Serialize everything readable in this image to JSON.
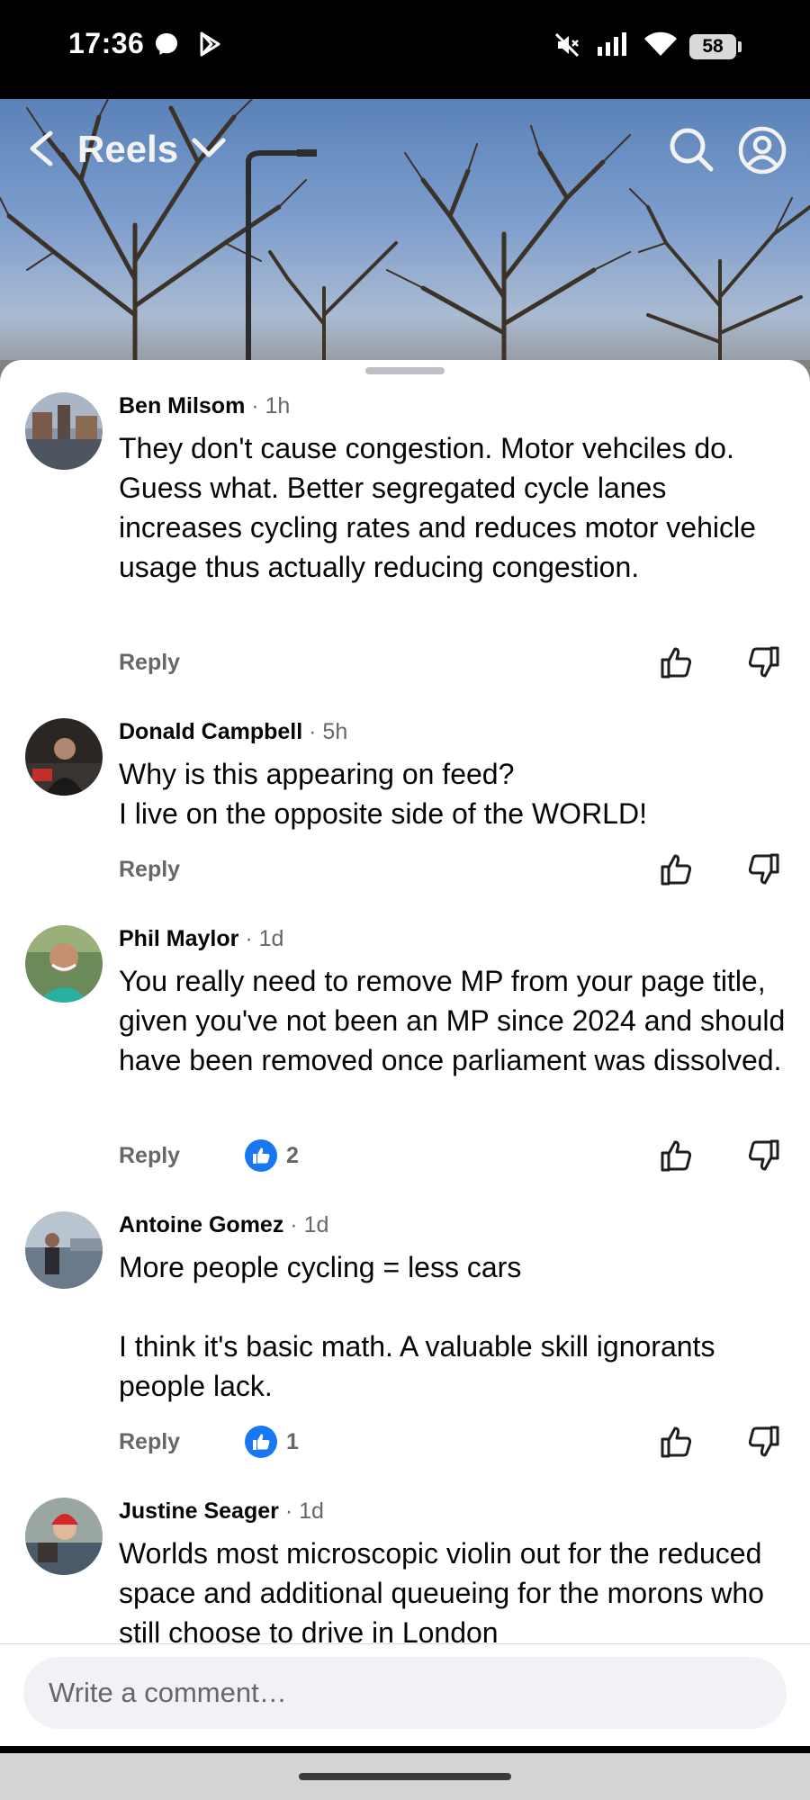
{
  "status_bar": {
    "time": "17:36",
    "battery": "58",
    "icons": [
      "messenger-icon",
      "play-store-icon",
      "mute-icon",
      "signal-icon",
      "wifi-icon",
      "battery-icon"
    ]
  },
  "header": {
    "title": "Reels"
  },
  "comments": [
    {
      "name": "Ben Milsom",
      "time": "· 1h",
      "lines": [
        "They don't cause congestion. Motor vehciles do. Guess what. Better segregated cycle lanes increases cycling rates and reduces motor vehicle usage thus actually reducing congestion."
      ],
      "reply_label": "Reply"
    },
    {
      "name": "Donald Campbell",
      "time": "· 5h",
      "lines": [
        "Why is this appearing on feed?",
        "I live on the opposite side of the WORLD!"
      ],
      "reply_label": "Reply"
    },
    {
      "name": "Phil Maylor",
      "time": "· 1d",
      "lines": [
        "You really need to remove MP from your page title, given you've not been an MP since 2024 and should have been removed once parliament was dissolved."
      ],
      "reply_label": "Reply",
      "reaction_count": "2"
    },
    {
      "name": "Antoine Gomez",
      "time": "· 1d",
      "lines": [
        "More people cycling = less cars",
        "",
        "I think it's basic math. A valuable skill ignorants people lack."
      ],
      "reply_label": "Reply",
      "reaction_count": "1"
    },
    {
      "name": "Justine Seager",
      "time": "· 1d",
      "lines": [
        "Worlds most microscopic violin out for the reduced space and additional queueing for the morons who still choose to drive in London"
      ]
    }
  ],
  "composer": {
    "placeholder": "Write a comment…"
  },
  "colors": {
    "like_blue": "#1877f2",
    "secondary_text": "#65676b",
    "input_bg": "#f0f2f5"
  }
}
